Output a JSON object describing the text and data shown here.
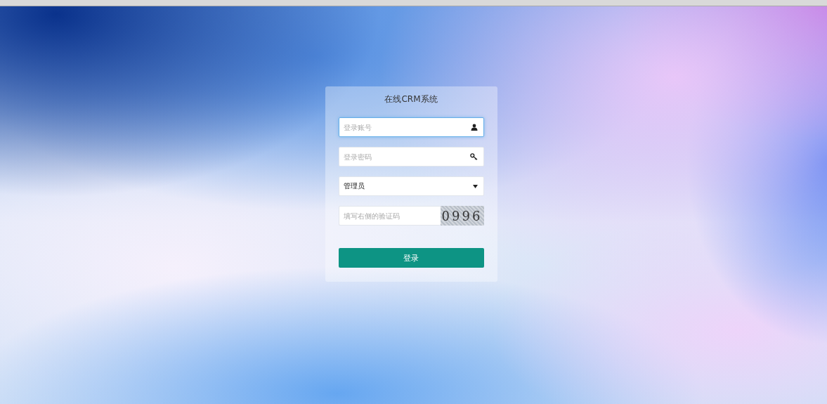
{
  "login_card": {
    "title": "在线CRM系统",
    "fields": [
      {
        "kind": "text",
        "placeholder": "登录账号",
        "focused": true
      },
      {
        "kind": "password",
        "placeholder": "登录密码",
        "focused": false
      },
      {
        "kind": "select",
        "value": "管理员",
        "focused": false
      },
      {
        "kind": "captcha",
        "placeholder": "填写右侧的验证码",
        "captcha": "0996",
        "focused": false
      }
    ],
    "submit": "登录"
  }
}
